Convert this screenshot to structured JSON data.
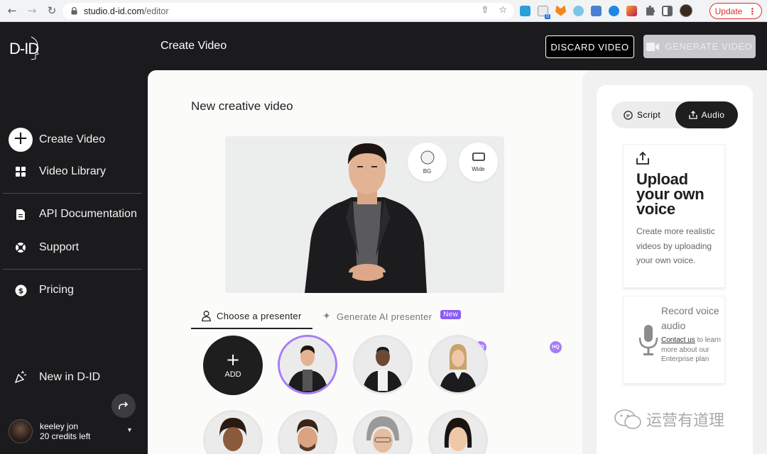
{
  "browser": {
    "url_domain": "studio.d-id.com",
    "url_path": "/editor",
    "update_label": "Update",
    "ext_badge": "0"
  },
  "sidebar": {
    "logo": "D-ID",
    "items": [
      {
        "label": "Create Video",
        "icon": "plus-icon"
      },
      {
        "label": "Video Library",
        "icon": "grid-icon"
      },
      {
        "label": "API Documentation",
        "icon": "document-icon"
      },
      {
        "label": "Support",
        "icon": "lifebuoy-icon"
      },
      {
        "label": "Pricing",
        "icon": "dollar-icon"
      },
      {
        "label": "New in D-ID",
        "icon": "party-icon"
      }
    ],
    "user": {
      "name": "keeley jon",
      "credits": "20 credits left"
    }
  },
  "topbar": {
    "title": "Create Video",
    "discard_label": "DISCARD VIDEO",
    "generate_label": "GENERATE VIDEO"
  },
  "editor": {
    "section_title": "New creative video",
    "bg_label": "BG",
    "wide_label": "Wide",
    "tabs": {
      "presenter": "Choose a presenter",
      "ai": "Generate AI presenter",
      "new_badge": "New"
    },
    "add_label": "ADD",
    "hq_label": "HQ"
  },
  "audio_panel": {
    "script_label": "Script",
    "audio_label": "Audio",
    "upload_title": "Upload your own voice",
    "upload_desc": "Create more realistic videos by uploading your own voice.",
    "record_title": "Record voice audio",
    "contact_link": "Contact us",
    "record_desc": " to learn more about our Enterprise plan"
  },
  "watermark": {
    "text": "运营有道理"
  },
  "colors": {
    "sidebar_bg": "#1b1b1d",
    "accent_purple": "#a77df7",
    "badge_purple": "#8a5cf6",
    "update_red": "#d93025"
  }
}
